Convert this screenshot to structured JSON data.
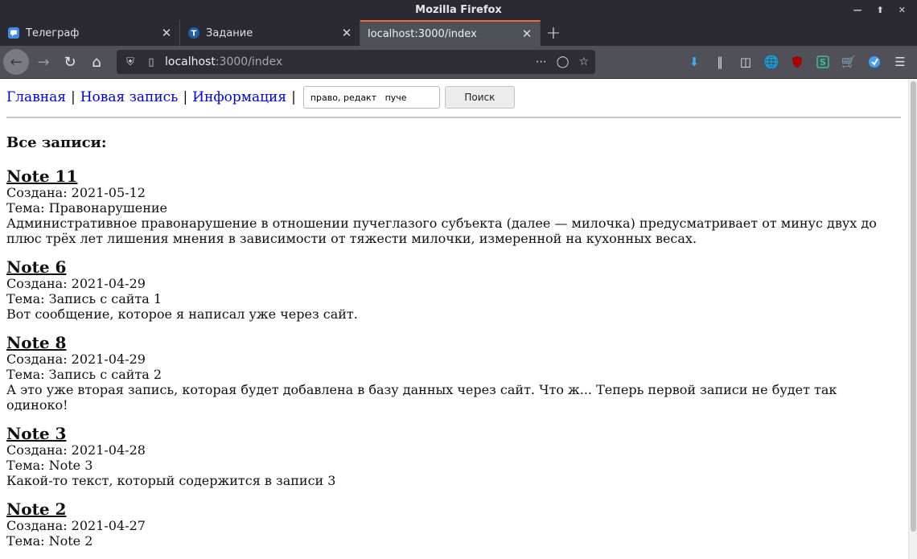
{
  "window": {
    "title": "Mozilla Firefox"
  },
  "tabs": [
    {
      "label": "Телеграф",
      "icon": "telegraph-icon"
    },
    {
      "label": "Задание",
      "icon": "task-icon"
    },
    {
      "label": "localhost:3000/index",
      "icon": "none"
    }
  ],
  "address": {
    "host": "localhost",
    "path": ":3000/index"
  },
  "page": {
    "nav": {
      "home": "Главная",
      "new_entry": "Новая запись",
      "info": "Информация",
      "sep": "|"
    },
    "search": {
      "value": "право, редакт   пуче",
      "button": "Поиск"
    },
    "heading": "Все записи:",
    "created_prefix": "Создана: ",
    "topic_prefix": "Тема: ",
    "notes": [
      {
        "title": "Note 11",
        "created": "2021-05-12",
        "topic": "Правонарушение",
        "text": "Административное правонарушение в отношении пучеглазого субъекта (далее — милочка) предусматривает от минус двух до плюс трёх лет лишения мнения в зависимости от тяжести милочки, измеренной на кухонных весах."
      },
      {
        "title": "Note 6",
        "created": "2021-04-29",
        "topic": "Запись с сайта 1",
        "text": "Вот сообщение, которое я написал уже через сайт."
      },
      {
        "title": "Note 8",
        "created": "2021-04-29",
        "topic": "Запись с сайта 2",
        "text": "А это уже вторая запись, которая будет добавлена в базу данных через сайт. Что ж... Теперь первой записи не будет так одиноко!"
      },
      {
        "title": "Note 3",
        "created": "2021-04-28",
        "topic": "Note 3",
        "text": "Какой-то текст, который содержится в записи 3"
      },
      {
        "title": "Note 2",
        "created": "2021-04-27",
        "topic": "Note 2",
        "text": ""
      }
    ]
  },
  "colors": {
    "link": "#0000ee",
    "tab_accent": "#e6723c",
    "chrome_dark": "#2b2a33",
    "chrome_mid": "#505058"
  }
}
